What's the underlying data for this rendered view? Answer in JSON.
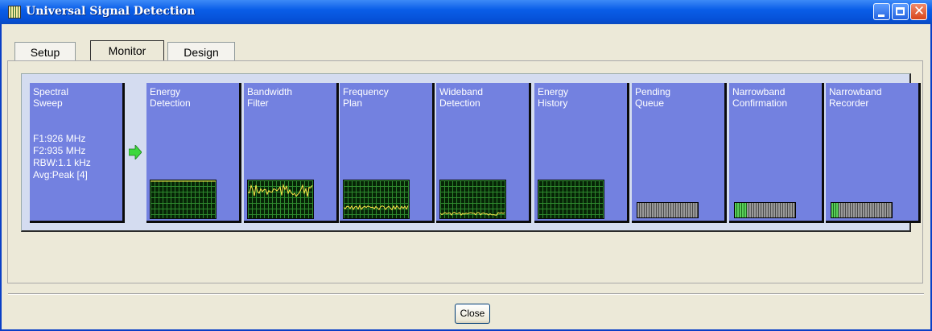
{
  "window": {
    "title": "Universal Signal Detection",
    "icon": "app-spectrum-icon",
    "controls": [
      "minimize-icon",
      "maximize-icon",
      "close-icon"
    ]
  },
  "tabs": [
    {
      "label": "Setup",
      "active": false
    },
    {
      "label": "Monitor",
      "active": true
    },
    {
      "label": "Design",
      "active": false
    }
  ],
  "stages": [
    {
      "label": "Spectral\nSweep",
      "info": "F1:926 MHz\nF2:935 MHz\nRBW:1.1 kHz\nAvg:Peak [4]",
      "display": "none"
    },
    {
      "label": "Energy\nDetection",
      "display": "scope"
    },
    {
      "label": "Bandwidth\nFilter",
      "display": "scope"
    },
    {
      "label": "Frequency\nPlan",
      "display": "scope"
    },
    {
      "label": "Wideband\nDetection",
      "display": "scope"
    },
    {
      "label": "Energy\nHistory",
      "display": "scope"
    },
    {
      "label": "Pending\nQueue",
      "display": "bar",
      "fill_fraction": 0
    },
    {
      "label": "Narrowband\nConfirmation",
      "display": "bar",
      "fill_fraction": 0.2
    },
    {
      "label": "Narrowband\nRecorder",
      "display": "bar",
      "fill_fraction": 0.12
    }
  ],
  "arrow_icon": "green-arrow-right-icon",
  "colors": {
    "stage": "#7381e0",
    "scope_bg": "#062406",
    "trace": "#ffe84a",
    "arrow": "#3dd83d"
  },
  "footer": {
    "close_label": "Close"
  }
}
